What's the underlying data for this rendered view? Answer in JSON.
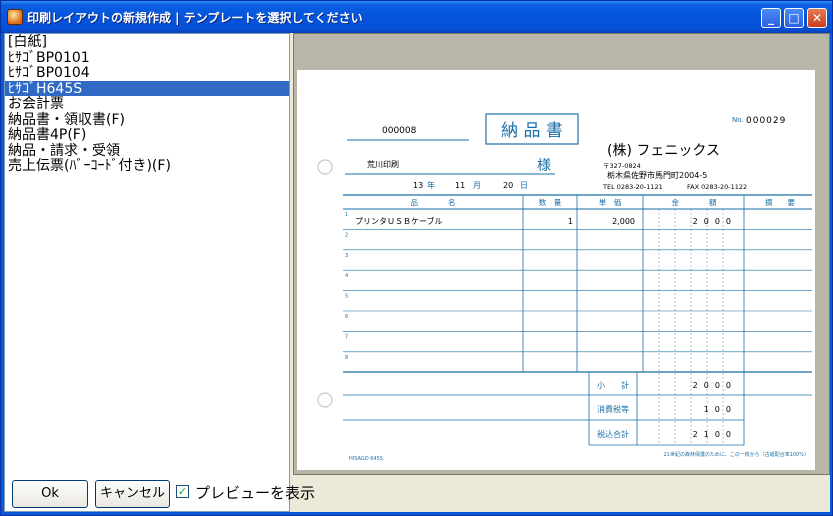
{
  "window": {
    "title": "印刷レイアウトの新規作成 | テンプレートを選択してください",
    "minimize": "_",
    "maximize": "□",
    "close": "✕"
  },
  "templates": {
    "items": [
      "[白紙]",
      "ﾋｻｺﾞBP0101",
      "ﾋｻｺﾞBP0104",
      "ﾋｻｺﾞH645S",
      "お会計票",
      "納品書・領収書(F)",
      "納品書4P(F)",
      "納品・請求・受領",
      "売上伝票(ﾊﾞｰｺｰﾄﾞ付き)(F)"
    ],
    "selected_index": 3
  },
  "invoice": {
    "number": "000008",
    "title": "納 品 書",
    "no_label": "No.",
    "no_value": "000029",
    "customer": "荒川印刷",
    "honorific": "様",
    "date_year": "13",
    "date_year_unit": "年",
    "date_month": "11",
    "date_month_unit": "月",
    "date_day": "20",
    "date_day_unit": "日",
    "company": "(株) フェニックス",
    "postal": "〒327-0824",
    "address": "栃木県佐野市馬門町2004-5",
    "tel": "TEL 0283-20-1121",
    "fax": "FAX 0283-20-1122",
    "columns": {
      "item": "品　　　　名",
      "qty": "数　量",
      "unit_price": "単　価",
      "amount": "金　　　　額",
      "note": "摘　　要"
    },
    "rows": [
      {
        "no": "1",
        "item": "プリンタＵＳＢケーブル",
        "qty": "1",
        "price": "2,000",
        "amount": "2000"
      },
      {
        "no": "2",
        "item": "",
        "qty": "",
        "price": "",
        "amount": ""
      },
      {
        "no": "3",
        "item": "",
        "qty": "",
        "price": "",
        "amount": ""
      },
      {
        "no": "4",
        "item": "",
        "qty": "",
        "price": "",
        "amount": ""
      },
      {
        "no": "5",
        "item": "",
        "qty": "",
        "price": "",
        "amount": ""
      },
      {
        "no": "6",
        "item": "",
        "qty": "",
        "price": "",
        "amount": ""
      },
      {
        "no": "7",
        "item": "",
        "qty": "",
        "price": "",
        "amount": ""
      },
      {
        "no": "8",
        "item": "",
        "qty": "",
        "price": "",
        "amount": ""
      }
    ],
    "subtotal_label": "小　　計",
    "subtotal": "2000",
    "tax_label": "消費税等",
    "tax": "100",
    "total_label": "税込合計",
    "total": "2100",
    "footer_brand": "HISAGO 645S",
    "footer_note": "21世紀の森林保護のために、この一枚から（古紙配合率100%）"
  },
  "buttons": {
    "ok": "Ok",
    "cancel": "キャンセル"
  },
  "preview_toggle": {
    "label": "プレビューを表示",
    "checked": true,
    "check_glyph": "✓"
  },
  "colors": {
    "invoice_blue": "#1a6fa8",
    "selection": "#316ac5"
  }
}
